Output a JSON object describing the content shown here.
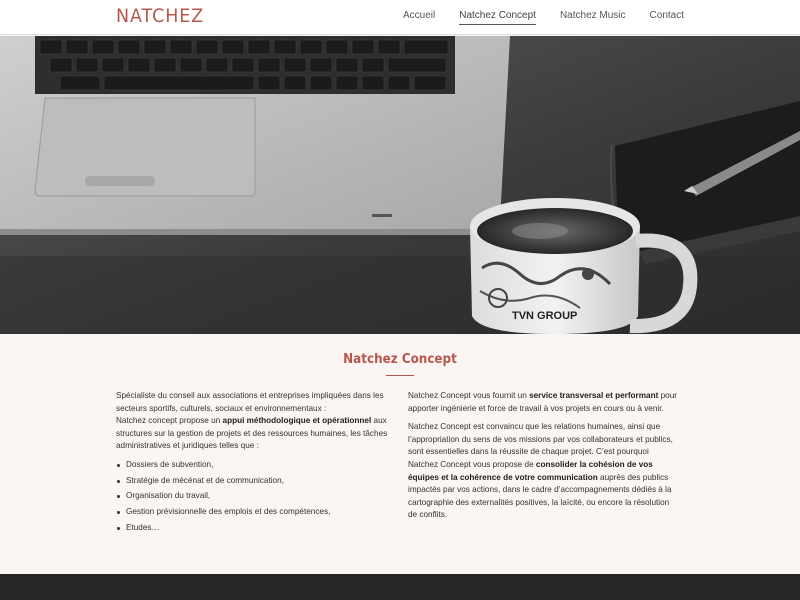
{
  "header": {
    "logo": "NATCHEZ",
    "nav": [
      {
        "label": "Accueil",
        "active": false
      },
      {
        "label": "Natchez Concept",
        "active": true
      },
      {
        "label": "Natchez Music",
        "active": false
      },
      {
        "label": "Contact",
        "active": false
      }
    ]
  },
  "main": {
    "title": "Natchez Concept",
    "left": {
      "intro": "Spécialiste du conseil aux associations et entreprises impliquées dans les secteurs sportifs, culturels, sociaux et environnementaux :",
      "p2_before": "Natchez concept propose un ",
      "p2_bold": "appui méthodologique et opérationnel",
      "p2_after": " aux structures sur la gestion de projets et des ressources humaines, les tâches administratives et juridiques telles que :",
      "list": [
        "Dossiers de subvention,",
        "Stratégie de mécénat et de communication,",
        "Organisation du travail,",
        "Gestion prévisionnelle des emplois et des compétences,",
        "Etudes…"
      ]
    },
    "right": {
      "p1_before": "Natchez Concept vous fournit un ",
      "p1_bold": "service transversal et performant",
      "p1_after": " pour apporter ingénierie et force de travail à vos projets en cours ou à venir.",
      "p2_before": "Natchez Concept est convaincu que les relations humaines, ainsi que l’appropriation du sens de vos missions par vos collaborateurs et publics, sont essentielles dans la réussite de chaque projet. C’est pourquoi Natchez Concept vous propose de ",
      "p2_bold": "consolider la cohésion de vos équipes et la cohérence de votre communication",
      "p2_after": " auprès des publics impactés par vos actions, dans le cadre d’accompagnements dédiés à la cartographie des externalités positives, la laïcité, ou encore la résolution de conflits."
    }
  },
  "hero": {
    "mug_text": "TVN GROUP",
    "alt": "hero-photo"
  },
  "colors": {
    "accent": "#b4574c",
    "background": "#fbf5f4",
    "footer": "#262626"
  }
}
